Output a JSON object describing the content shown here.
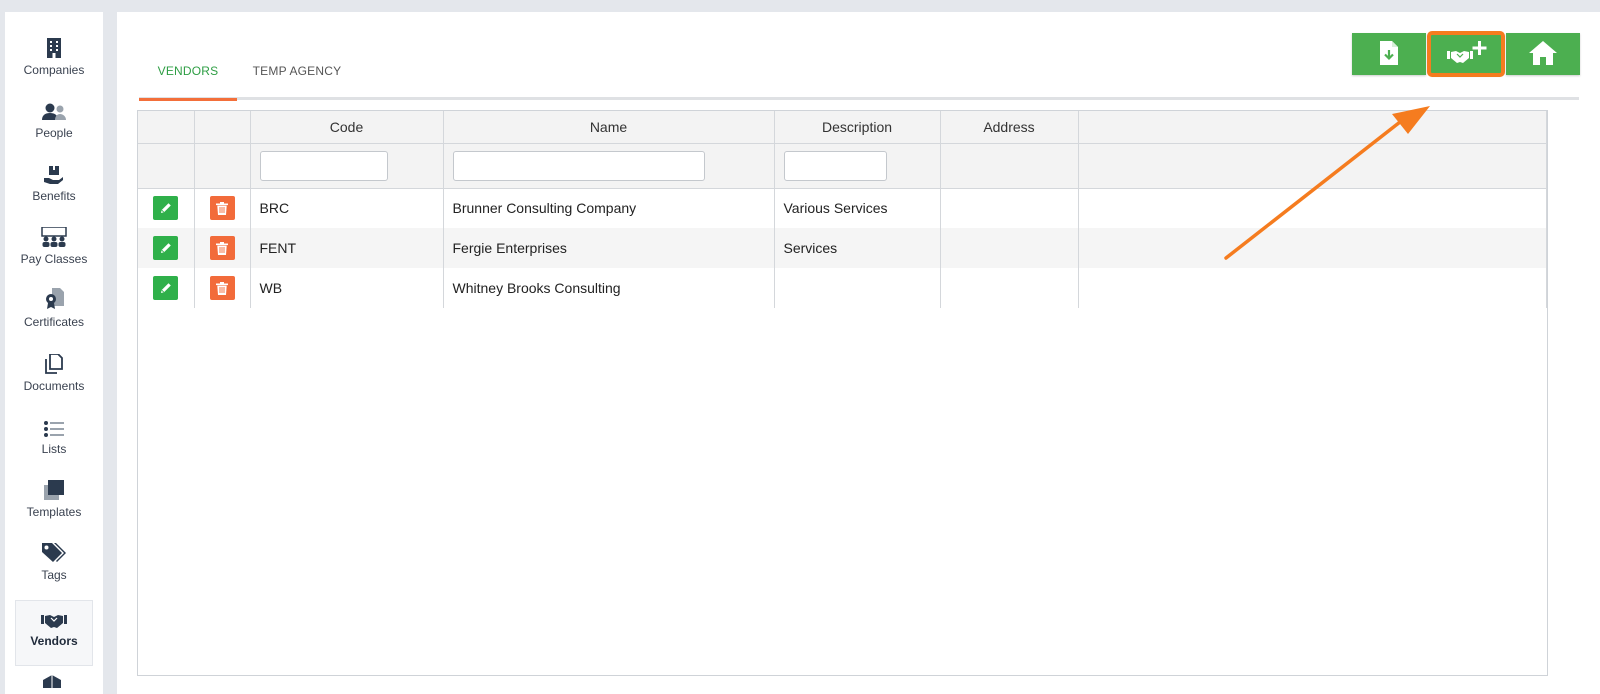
{
  "sidebar": {
    "items": [
      {
        "label": "Companies",
        "icon": "building-icon"
      },
      {
        "label": "People",
        "icon": "people-icon"
      },
      {
        "label": "Benefits",
        "icon": "hand-box-icon"
      },
      {
        "label": "Pay Classes",
        "icon": "group-icon"
      },
      {
        "label": "Certificates",
        "icon": "certificate-icon"
      },
      {
        "label": "Documents",
        "icon": "documents-icon"
      },
      {
        "label": "Lists",
        "icon": "list-icon"
      },
      {
        "label": "Templates",
        "icon": "templates-icon"
      },
      {
        "label": "Tags",
        "icon": "tags-icon"
      },
      {
        "label": "Vendors",
        "icon": "handshake-icon",
        "active": true
      }
    ]
  },
  "tabs": {
    "vendors": "VENDORS",
    "temp_agency": "TEMP AGENCY"
  },
  "toolbar": {
    "buttons": [
      "download-file-icon",
      "add-vendor-handshake-icon",
      "home-icon"
    ]
  },
  "grid": {
    "columns": [
      "",
      "",
      "Code",
      "Name",
      "Description",
      "Address",
      ""
    ],
    "rows": [
      {
        "code": "BRC",
        "name": "Brunner Consulting Company",
        "description": "Various Services",
        "address": ""
      },
      {
        "code": "FENT",
        "name": "Fergie Enterprises",
        "description": "Services",
        "address": ""
      },
      {
        "code": "WB",
        "name": "Whitney Brooks Consulting",
        "description": "",
        "address": ""
      }
    ]
  },
  "colors": {
    "green": "#4caf50",
    "edit_green": "#2fb04a",
    "delete_orange": "#f26b3a",
    "annotation_orange": "#f57c1f"
  }
}
